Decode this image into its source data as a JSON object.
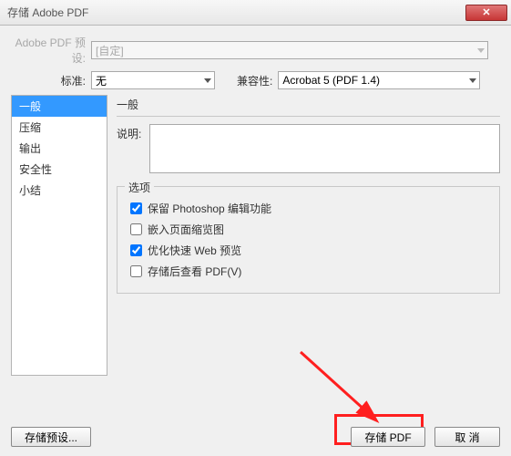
{
  "window": {
    "title": "存储 Adobe PDF"
  },
  "preset": {
    "label": "Adobe PDF 预设:",
    "value": "[自定]"
  },
  "standard": {
    "label": "标准:",
    "value": "无"
  },
  "compat": {
    "label": "兼容性:",
    "value": "Acrobat 5 (PDF 1.4)"
  },
  "sidebar": {
    "items": [
      "一般",
      "压缩",
      "输出",
      "安全性",
      "小结"
    ],
    "selected_index": 0
  },
  "panel": {
    "title": "一般",
    "description_label": "说明:"
  },
  "options": {
    "legend": "选项",
    "items": [
      {
        "label": "保留 Photoshop 编辑功能",
        "checked": true
      },
      {
        "label": "嵌入页面缩览图",
        "checked": false
      },
      {
        "label": "优化快速 Web 预览",
        "checked": true
      },
      {
        "label": "存储后查看 PDF(V)",
        "checked": false
      }
    ]
  },
  "buttons": {
    "save_preset": "存储预设...",
    "save_pdf": "存储 PDF",
    "cancel": "取 消"
  }
}
